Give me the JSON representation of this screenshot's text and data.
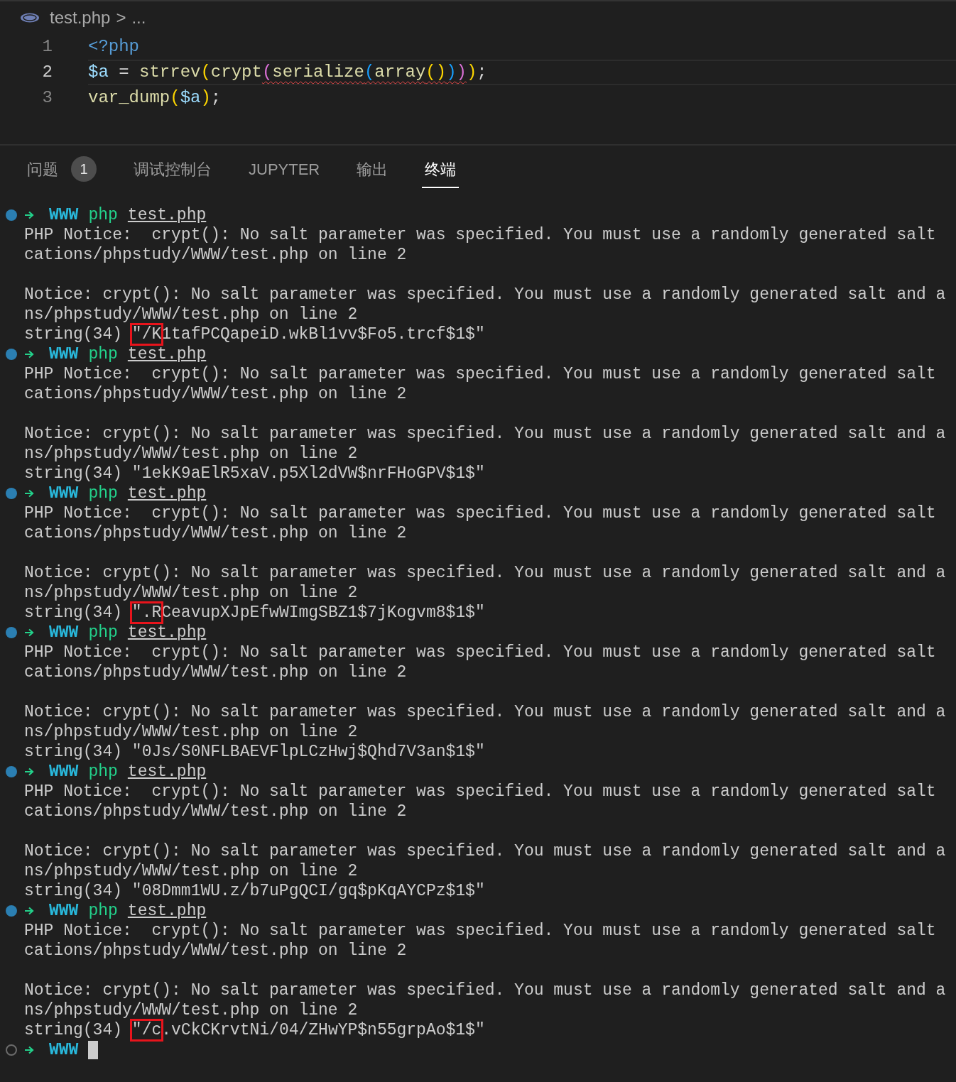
{
  "editor": {
    "breadcrumb": {
      "file": "test.php",
      "separator": ">",
      "more": "..."
    },
    "lines": [
      {
        "number": "1",
        "current": false,
        "tokens": [
          {
            "text": "<?php",
            "kind": "tag",
            "error": false
          }
        ]
      },
      {
        "number": "2",
        "current": true,
        "tokens": [
          {
            "text": "$a",
            "kind": "var",
            "error": false
          },
          {
            "text": " = ",
            "kind": "plain",
            "error": false
          },
          {
            "text": "strrev",
            "kind": "fn",
            "error": false
          },
          {
            "text": "(",
            "kind": "bracket1",
            "error": false
          },
          {
            "text": "crypt",
            "kind": "fn",
            "error": false
          },
          {
            "text": "(",
            "kind": "bracket2",
            "error": true
          },
          {
            "text": "serialize",
            "kind": "fn",
            "error": true
          },
          {
            "text": "(",
            "kind": "bracket3",
            "error": true
          },
          {
            "text": "array",
            "kind": "fn",
            "error": true
          },
          {
            "text": "()",
            "kind": "bracket1",
            "error": true
          },
          {
            "text": ")",
            "kind": "bracket3",
            "error": true
          },
          {
            "text": ")",
            "kind": "bracket2",
            "error": true
          },
          {
            "text": ")",
            "kind": "bracket1",
            "error": false
          },
          {
            "text": ";",
            "kind": "plain",
            "error": false
          }
        ]
      },
      {
        "number": "3",
        "current": false,
        "tokens": [
          {
            "text": "var_dump",
            "kind": "fn",
            "error": false
          },
          {
            "text": "(",
            "kind": "bracket1",
            "error": false
          },
          {
            "text": "$a",
            "kind": "var",
            "error": false
          },
          {
            "text": ")",
            "kind": "bracket1",
            "error": false
          },
          {
            "text": ";",
            "kind": "plain",
            "error": false
          }
        ]
      }
    ]
  },
  "panel_tabs": [
    {
      "label": "问题",
      "badge": "1",
      "selected": false
    },
    {
      "label": "调试控制台",
      "selected": false
    },
    {
      "label": "JUPYTER",
      "selected": false
    },
    {
      "label": "输出",
      "selected": false
    },
    {
      "label": "终端",
      "selected": true
    }
  ],
  "terminal": {
    "lines": [
      {
        "kind": "prompt",
        "done": true,
        "dir": "WWW",
        "command": "php",
        "arg": "test.php"
      },
      {
        "kind": "text",
        "text": "PHP Notice:  crypt(): No salt parameter was specified. You must use a randomly generated salt"
      },
      {
        "kind": "text",
        "text": "cations/phpstudy/WWW/test.php on line 2"
      },
      {
        "kind": "blank"
      },
      {
        "kind": "text",
        "text": "Notice: crypt(): No salt parameter was specified. You must use a randomly generated salt and a"
      },
      {
        "kind": "text",
        "text": "ns/phpstudy/WWW/test.php on line 2"
      },
      {
        "kind": "marked",
        "segments": [
          {
            "text": "string(34) ",
            "marked": false
          },
          {
            "text": "\"/K",
            "marked": true
          },
          {
            "text": "1tafPCQapeiD.wkBl1vv$Fo5.trcf$1$\"",
            "marked": false
          }
        ]
      },
      {
        "kind": "prompt",
        "done": true,
        "dir": "WWW",
        "command": "php",
        "arg": "test.php"
      },
      {
        "kind": "text",
        "text": "PHP Notice:  crypt(): No salt parameter was specified. You must use a randomly generated salt"
      },
      {
        "kind": "text",
        "text": "cations/phpstudy/WWW/test.php on line 2"
      },
      {
        "kind": "blank"
      },
      {
        "kind": "text",
        "text": "Notice: crypt(): No salt parameter was specified. You must use a randomly generated salt and a"
      },
      {
        "kind": "text",
        "text": "ns/phpstudy/WWW/test.php on line 2"
      },
      {
        "kind": "text",
        "text": "string(34) \"1ekK9aElR5xaV.p5Xl2dVW$nrFHoGPV$1$\""
      },
      {
        "kind": "prompt",
        "done": true,
        "dir": "WWW",
        "command": "php",
        "arg": "test.php"
      },
      {
        "kind": "text",
        "text": "PHP Notice:  crypt(): No salt parameter was specified. You must use a randomly generated salt"
      },
      {
        "kind": "text",
        "text": "cations/phpstudy/WWW/test.php on line 2"
      },
      {
        "kind": "blank"
      },
      {
        "kind": "text",
        "text": "Notice: crypt(): No salt parameter was specified. You must use a randomly generated salt and a"
      },
      {
        "kind": "text",
        "text": "ns/phpstudy/WWW/test.php on line 2"
      },
      {
        "kind": "marked",
        "segments": [
          {
            "text": "string(34) ",
            "marked": false
          },
          {
            "text": "\".R",
            "marked": true
          },
          {
            "text": "CeavupXJpEfwWImgSBZ1$7jKogvm8$1$\"",
            "marked": false
          }
        ]
      },
      {
        "kind": "prompt",
        "done": true,
        "dir": "WWW",
        "command": "php",
        "arg": "test.php"
      },
      {
        "kind": "text",
        "text": "PHP Notice:  crypt(): No salt parameter was specified. You must use a randomly generated salt"
      },
      {
        "kind": "text",
        "text": "cations/phpstudy/WWW/test.php on line 2"
      },
      {
        "kind": "blank"
      },
      {
        "kind": "text",
        "text": "Notice: crypt(): No salt parameter was specified. You must use a randomly generated salt and a"
      },
      {
        "kind": "text",
        "text": "ns/phpstudy/WWW/test.php on line 2"
      },
      {
        "kind": "text",
        "text": "string(34) \"0Js/S0NFLBAEVFlpLCzHwj$Qhd7V3an$1$\""
      },
      {
        "kind": "prompt",
        "done": true,
        "dir": "WWW",
        "command": "php",
        "arg": "test.php"
      },
      {
        "kind": "text",
        "text": "PHP Notice:  crypt(): No salt parameter was specified. You must use a randomly generated salt"
      },
      {
        "kind": "text",
        "text": "cations/phpstudy/WWW/test.php on line 2"
      },
      {
        "kind": "blank"
      },
      {
        "kind": "text",
        "text": "Notice: crypt(): No salt parameter was specified. You must use a randomly generated salt and a"
      },
      {
        "kind": "text",
        "text": "ns/phpstudy/WWW/test.php on line 2"
      },
      {
        "kind": "text",
        "text": "string(34) \"08Dmm1WU.z/b7uPgQCI/gq$pKqAYCPz$1$\""
      },
      {
        "kind": "prompt",
        "done": true,
        "dir": "WWW",
        "command": "php",
        "arg": "test.php"
      },
      {
        "kind": "text",
        "text": "PHP Notice:  crypt(): No salt parameter was specified. You must use a randomly generated salt"
      },
      {
        "kind": "text",
        "text": "cations/phpstudy/WWW/test.php on line 2"
      },
      {
        "kind": "blank"
      },
      {
        "kind": "text",
        "text": "Notice: crypt(): No salt parameter was specified. You must use a randomly generated salt and a"
      },
      {
        "kind": "text",
        "text": "ns/phpstudy/WWW/test.php on line 2"
      },
      {
        "kind": "marked",
        "segments": [
          {
            "text": "string(34) ",
            "marked": false
          },
          {
            "text": "\"/c",
            "marked": true
          },
          {
            "text": ".vCkCKrvtNi/04/ZHwYP$n55grpAo$1$\"",
            "marked": false
          }
        ]
      },
      {
        "kind": "prompt",
        "done": false,
        "dir": "WWW",
        "cursor": true
      }
    ]
  }
}
